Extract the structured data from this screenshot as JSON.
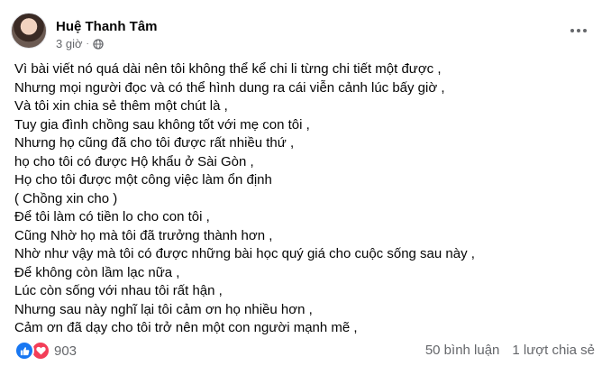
{
  "post": {
    "author": "Huệ Thanh Tâm",
    "time": "3 giờ",
    "separator": "·",
    "icons": {
      "privacy": "globe-icon",
      "menu": "more-options-icon"
    },
    "lines": [
      "Vì bài viết nó quá dài nên tôi không thể kể chi li từng chi tiết một được ,",
      "Nhưng mọi người đọc và có thể hình dung ra cái viễn cảnh lúc bấy giờ ,",
      "Và tôi xin chia sẻ thêm một chút là ,",
      "Tuy gia đình chồng sau không tốt với mẹ con tôi ,",
      "Nhưng họ cũng đã cho tôi được rất nhiều thứ ,",
      "họ cho tôi có được Hộ khẩu ở Sài Gòn ,",
      "Họ cho tôi được một công việc làm ổn định",
      "( Chồng xin cho )",
      "Để tôi làm có tiền lo cho con tôi ,",
      "Cũng Nhờ họ mà tôi đã trưởng thành hơn ,",
      "Nhờ như vậy mà tôi có được những bài học quý giá cho cuộc sống sau này ,",
      "Để không còn lầm lạc nữa ,",
      "Lúc còn sống với nhau tôi rất hận ,",
      "Nhưng sau này nghĩ lại tôi cảm ơn họ  nhiều hơn ,",
      "Cảm ơn đã dạy cho tôi trở nên một con người mạnh mẽ ,"
    ]
  },
  "footer": {
    "reaction_count": "903",
    "reaction_icons": [
      "like-icon",
      "love-icon"
    ],
    "comments": "50 bình luận",
    "shares": "1 lượt chia sẻ"
  },
  "colors": {
    "like": "#1877f2",
    "love": "#f33e58",
    "secondary_text": "#65676b"
  }
}
